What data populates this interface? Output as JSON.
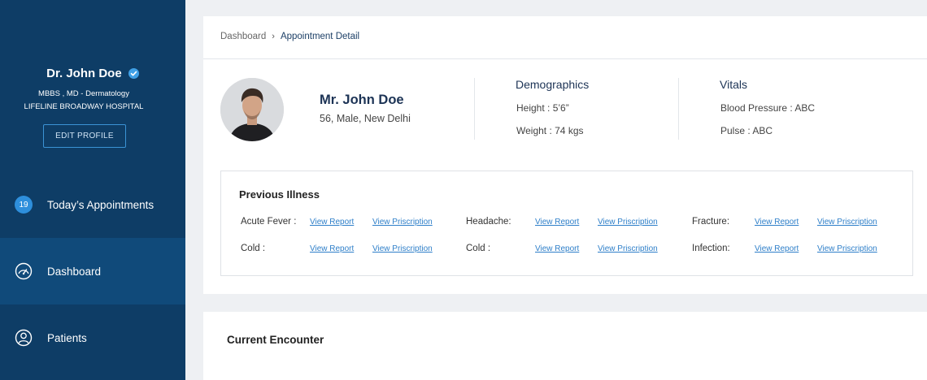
{
  "sidebar": {
    "doctor_name": "Dr. John Doe",
    "qualification": "MBBS , MD - Dermatology",
    "hospital": "LIFELINE BROADWAY HOSPITAL",
    "edit_profile_label": "EDIT PROFILE",
    "nav": [
      {
        "label": "Today’s Appointments",
        "badge": "19",
        "icon": "badge"
      },
      {
        "label": "Dashboard",
        "icon": "speedometer-icon",
        "active": true
      },
      {
        "label": "Patients",
        "icon": "user-icon"
      }
    ]
  },
  "breadcrumb": {
    "root": "Dashboard",
    "current": "Appointment Detail"
  },
  "patient": {
    "name": "Mr. John Doe",
    "info": "56, Male, New Delhi"
  },
  "demographics": {
    "title": "Demographics",
    "height": "Height : 5’6”",
    "weight": "Weight : 74 kgs"
  },
  "vitals": {
    "title": "Vitals",
    "bp": "Blood Pressure : ABC",
    "pulse": "Pulse : ABC"
  },
  "previous_illness": {
    "title": "Previous Illness",
    "link_report": "View Report",
    "link_prescription": "View Priscription",
    "rows": [
      [
        "Acute Fever :",
        "Headache:",
        "Fracture:"
      ],
      [
        "Cold :",
        "Cold :",
        "Infection:"
      ]
    ]
  },
  "current_encounter": {
    "title": "Current Encounter"
  },
  "colors": {
    "sidebar": "#0e3d66",
    "sidebar_active": "#104a7a",
    "accent": "#2e8fdc",
    "link": "#2e7fc9"
  }
}
